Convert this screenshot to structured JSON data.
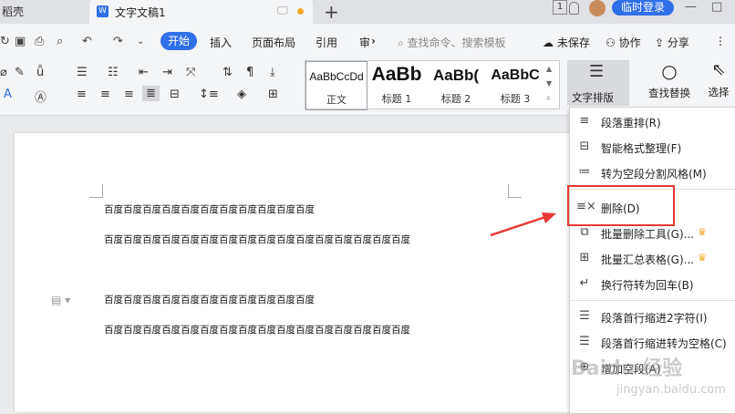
{
  "titlebar": {
    "prev_tab": "稻壳",
    "doc_badge": "W",
    "active_tab": "文字文稿1",
    "monitor_glyph": "🖵",
    "new_tab": "+",
    "page_num": "1",
    "login": "临时登录",
    "min": "—",
    "max": "□"
  },
  "menubar": {
    "tabs": [
      "开始",
      "插入",
      "页面布局",
      "引用",
      "审"
    ],
    "more": "›",
    "search_placeholder": "查找命令、搜索模板",
    "unsaved": "未保存",
    "collab": "协作",
    "share": "分享",
    "more_dots": "⋮"
  },
  "styles": {
    "items": [
      {
        "preview": "AaBbCcDd",
        "name": "正文"
      },
      {
        "preview": "AaBb",
        "name": "标题 1"
      },
      {
        "preview": "AaBb(",
        "name": "标题 2"
      },
      {
        "preview": "AaBbC",
        "name": "标题 3"
      }
    ]
  },
  "ribbon": {
    "text_layout": "文字排版",
    "find_replace": "查找替换",
    "select": "选择"
  },
  "document": {
    "lines": [
      "百度百度百度百度百度百度百度百度百度百度百度",
      "百度百度百度百度百度百度百度百度百度百度百度百度百度百度百度百度",
      "百度百度百度百度百度百度百度百度百度百度百度",
      "百度百度百度百度百度百度百度百度百度百度百度百度百度百度百度百度"
    ]
  },
  "dropdown": {
    "items": [
      {
        "label": "段落重排(R)",
        "icon": "paragraph-reflow-icon",
        "crown": false
      },
      {
        "label": "智能格式整理(F)",
        "icon": "smart-format-icon",
        "crown": false
      },
      {
        "label": "转为空段分割风格(M)",
        "icon": "blank-paragraph-split-icon",
        "crown": false
      },
      {
        "label": "删除(D)",
        "icon": "delete-lines-icon",
        "crown": false
      },
      {
        "label": "批量删除工具(G)...",
        "icon": "batch-delete-icon",
        "crown": true
      },
      {
        "label": "批量汇总表格(G)...",
        "icon": "batch-summary-table-icon",
        "crown": true
      },
      {
        "label": "换行符转为回车(B)",
        "icon": "line-break-to-enter-icon",
        "crown": false
      },
      {
        "label": "段落首行缩进2字符(I)",
        "icon": "first-line-indent-icon",
        "crown": false
      },
      {
        "label": "段落首行缩进转为空格(C)",
        "icon": "indent-to-space-icon",
        "crown": false
      },
      {
        "label": "增加空段(A)",
        "icon": "add-blank-paragraph-icon",
        "crown": false
      }
    ]
  },
  "watermark": {
    "logo_text": "Baidu 经验",
    "url": "jingyan.baidu.com"
  },
  "colors": {
    "accent": "#2f6fe8",
    "highlight_box": "#e53935",
    "arrow": "#e53935",
    "crown": "#f5a623"
  }
}
